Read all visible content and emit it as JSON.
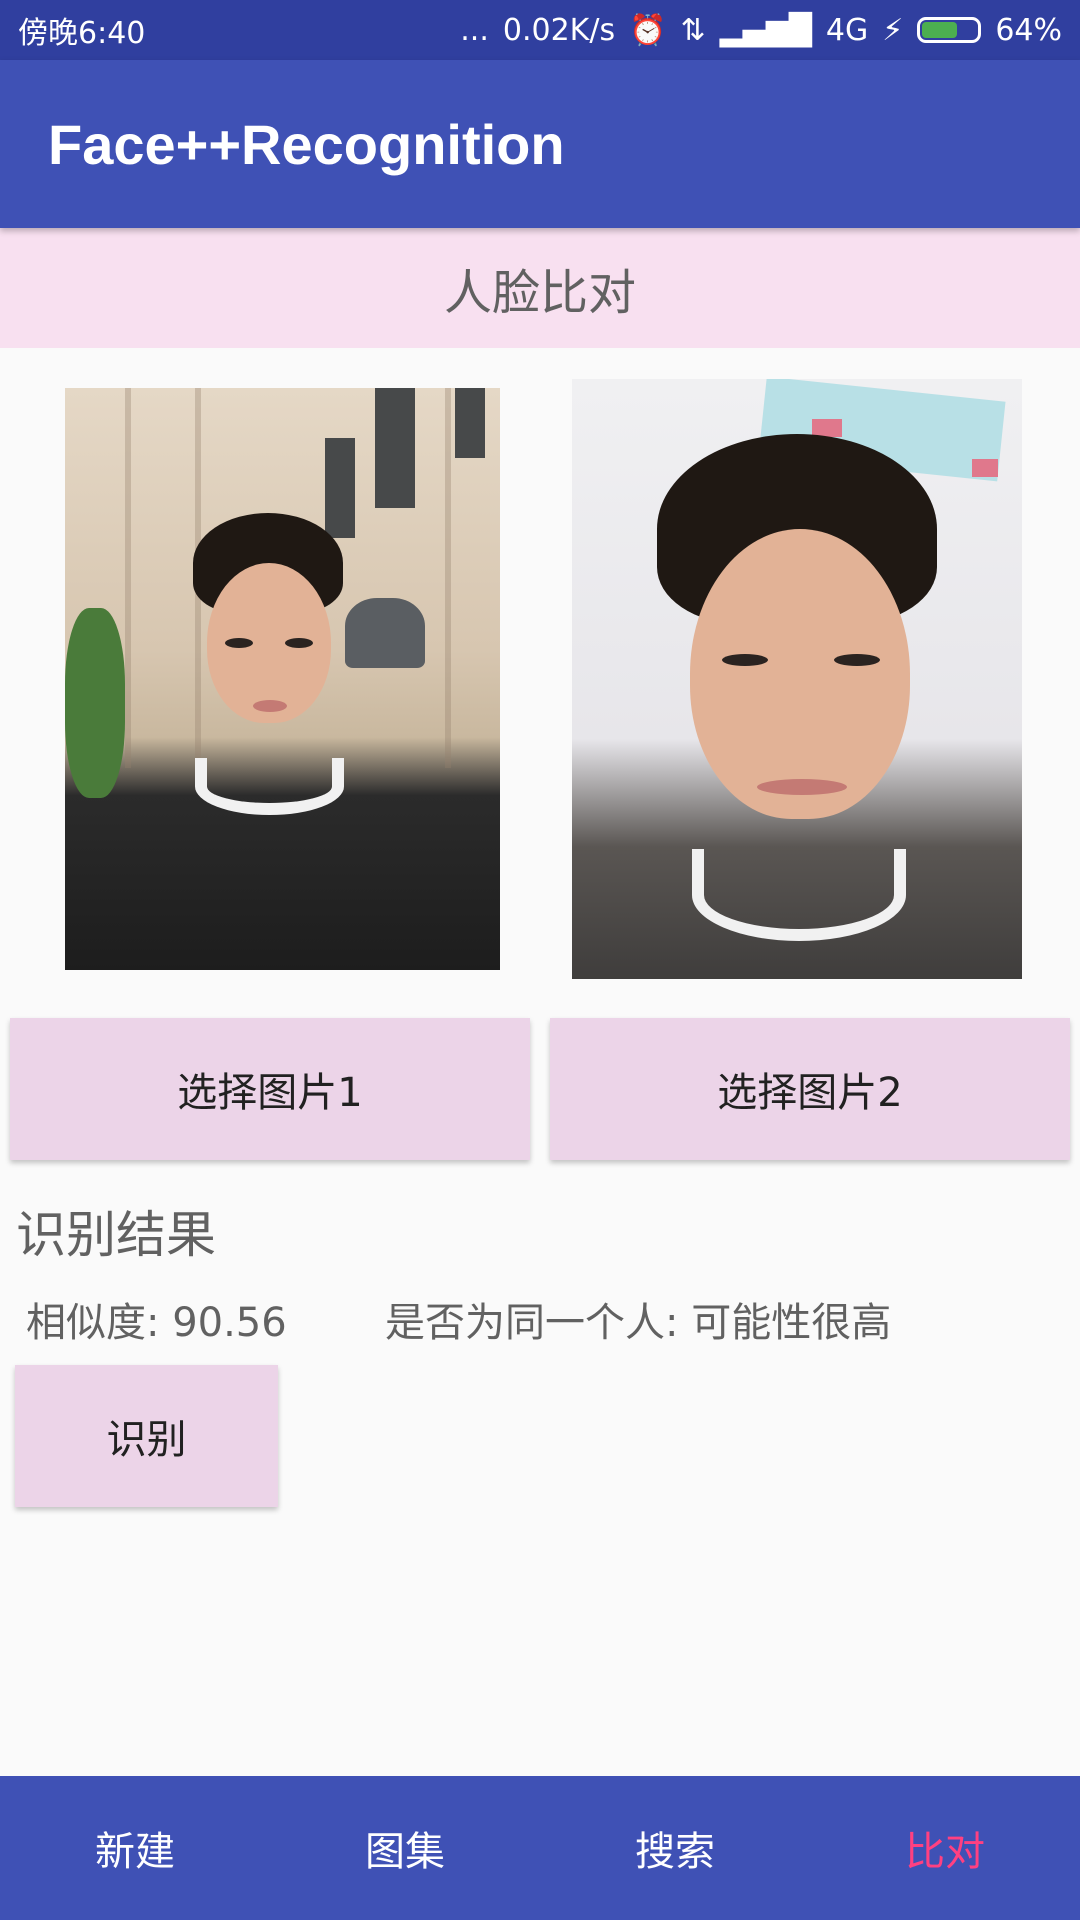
{
  "status_bar": {
    "time": "傍晚6:40",
    "dots": "...",
    "speed": "0.02K/s",
    "network": "4G",
    "battery": "64%",
    "battery_level": 0.64
  },
  "app_bar": {
    "title": "Face++Recognition"
  },
  "section": {
    "title": "人脸比对"
  },
  "buttons": {
    "pick1": "选择图片1",
    "pick2": "选择图片2",
    "recognize": "识别"
  },
  "result": {
    "title": "识别结果",
    "similarity": "相似度: 90.56",
    "same_person": "是否为同一个人: 可能性很高"
  },
  "bottom_nav": {
    "items": [
      {
        "label": "新建"
      },
      {
        "label": "图集"
      },
      {
        "label": "搜索"
      },
      {
        "label": "比对"
      }
    ],
    "active_index": 3
  },
  "colors": {
    "primary": "#3f51b5",
    "primary_dark": "#303f9f",
    "accent": "#ff4081",
    "section_bg": "#f8e0f0",
    "button_bg": "#ecd4e8"
  }
}
